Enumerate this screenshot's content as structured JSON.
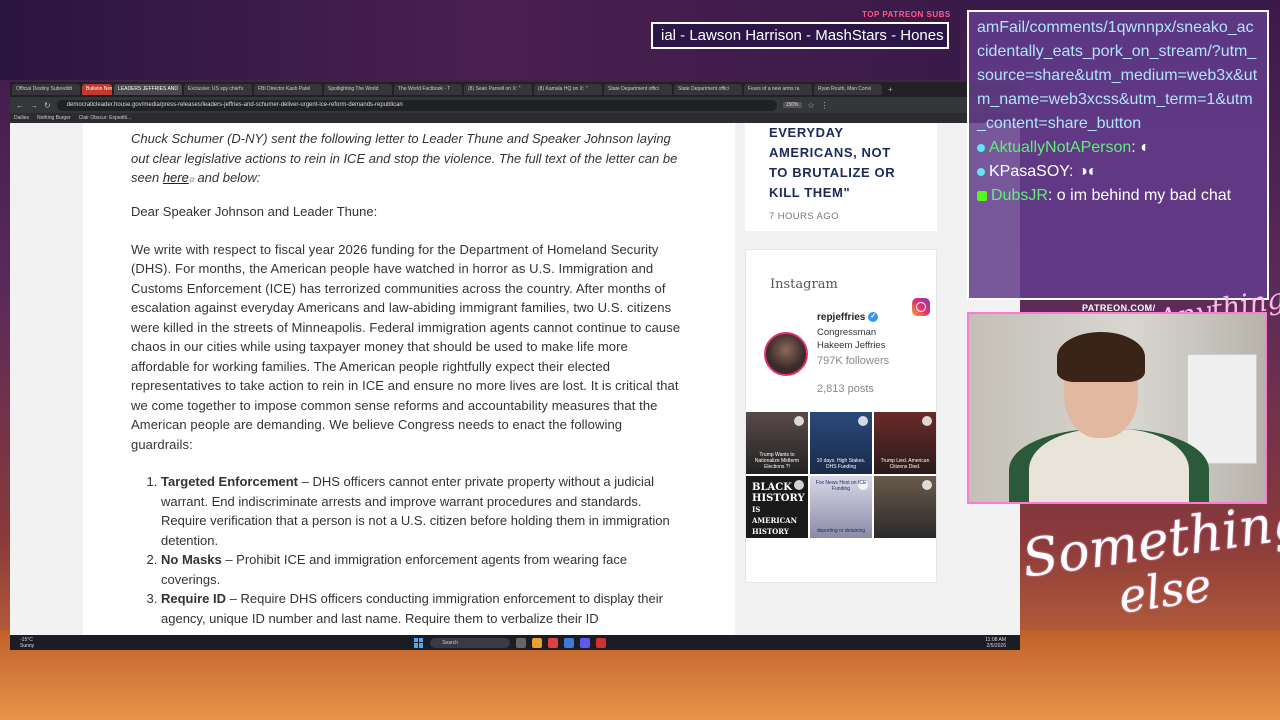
{
  "overlay": {
    "ticker_label": "TOP PATREON SUBS",
    "ticker_text": "ial - Lawson Harrison - MashStars - Hones",
    "patreon_label": "PATREON.COM/",
    "logo_line1": "Something",
    "logo_line2": "else",
    "logo_small": "Anything else?"
  },
  "browser": {
    "tabs": [
      {
        "label": "Official Destiny Subreddit"
      },
      {
        "label": "Bulletin News",
        "variant": "red"
      },
      {
        "label": "LEADERS JEFFRIES AND",
        "active": true
      },
      {
        "label": "Exclusive: US spy chief's"
      },
      {
        "label": "FBI Director Kash Patel"
      },
      {
        "label": "Spotlighting The World"
      },
      {
        "label": "The World Factbook - T"
      },
      {
        "label": "(8) Sean Parnell on X: \""
      },
      {
        "label": "(8) Kamala HQ on X: \""
      },
      {
        "label": "State Department offici"
      },
      {
        "label": "State Department offici"
      },
      {
        "label": "Fears of a new arms ra"
      },
      {
        "label": "Ryan Routh, Man Convi"
      }
    ],
    "url": "democraticleader.house.gov/media/press-releases/leaders-jeffries-and-schumer-deliver-urgent-ice-reform-demands-republican",
    "zoom": "150%",
    "bookmarks": [
      "Dailies",
      "Nothing Burger",
      "Clair Obscur: Expediti..."
    ]
  },
  "article": {
    "intro_text": "Chuck Schumer (D-NY) sent the following letter to Leader Thune and Speaker Johnson laying out clear legislative actions to rein in ICE and stop the violence. The full text of the letter can be seen ",
    "intro_link": "here",
    "intro_tail": " and below:",
    "salutation": "Dear Speaker Johnson and Leader Thune:",
    "body": "We write with respect to fiscal year 2026 funding for the Department of Homeland Security (DHS). For months, the American people have watched in horror as U.S. Immigration and Customs Enforcement (ICE) has terrorized communities across the country. After months of escalation against everyday Americans and law-abiding immigrant families, two U.S. citizens were killed in the streets of Minneapolis. Federal immigration agents cannot continue to cause chaos in our cities while using taxpayer money that should be used to make life more affordable for working families. The American people rightfully expect their elected representatives to take action to rein in ICE and ensure no more lives are lost. It is critical that we come together to impose common sense reforms and accountability measures that the American people are demanding. We believe Congress needs to enact the following guardrails:",
    "list": [
      {
        "title": "Targeted Enforcement",
        "text": " – DHS officers cannot enter private property without a judicial warrant. End indiscriminate arrests and improve warrant procedures and standards. Require verification that a person is not a U.S. citizen before holding them in immigration detention."
      },
      {
        "title": "No Masks",
        "text": " – Prohibit ICE and immigration enforcement agents from wearing face coverings."
      },
      {
        "title": "Require ID",
        "text": " – Require DHS officers conducting immigration enforcement to display their agency, unique ID number and last name. Require them to verbalize their ID"
      }
    ]
  },
  "sidebar": {
    "news_title": "EVERYDAY AMERICANS, NOT TO BRUTALIZE OR KILL THEM\"",
    "news_time": "7 HOURS AGO",
    "instagram": {
      "heading": "Instagram",
      "handle": "repjeffries",
      "role": "Congressman",
      "name": "Hakeem Jeffries",
      "followers": "797K followers",
      "posts": "2,813 posts",
      "thumbs": [
        {
          "caption": "Trump Wants to Nationalize Midterm Elections ?!"
        },
        {
          "caption": "10 days. High Stakes. DHS Funding"
        },
        {
          "caption": "Trump Lied. American Citizens Died."
        },
        {
          "caption": ""
        },
        {
          "caption": "Fox News Host on ICE Funding"
        },
        {
          "caption": ""
        }
      ],
      "black_history": {
        "line1": "BLACK",
        "line2": "HISTORY",
        "line3": "IS",
        "line4": "AMERICAN",
        "line5": "HISTORY"
      },
      "thumb5_sub": "deporting or detaining"
    }
  },
  "taskbar": {
    "weather_temp": "-15°C",
    "weather_desc": "Sunny",
    "search": "Search",
    "time": "11:08 AM",
    "date": "2/5/2026"
  },
  "chat": {
    "link": "amFail/comments/1qwnnpx/sneako_accidentally_eats_pork_on_stream/?utm_source=share&utm_medium=web3x&utm_name=web3xcss&utm_term=1&utm_content=share_button",
    "messages": [
      {
        "user": "AktuallyNotAPerson",
        "text": "",
        "color": "#5ef07a"
      },
      {
        "user": "KPasaSOY",
        "text": "",
        "color": "#5ee8f0"
      },
      {
        "user": "DubsJR",
        "text": "o im behind my bad chat",
        "color": "#5ef07a"
      }
    ]
  }
}
